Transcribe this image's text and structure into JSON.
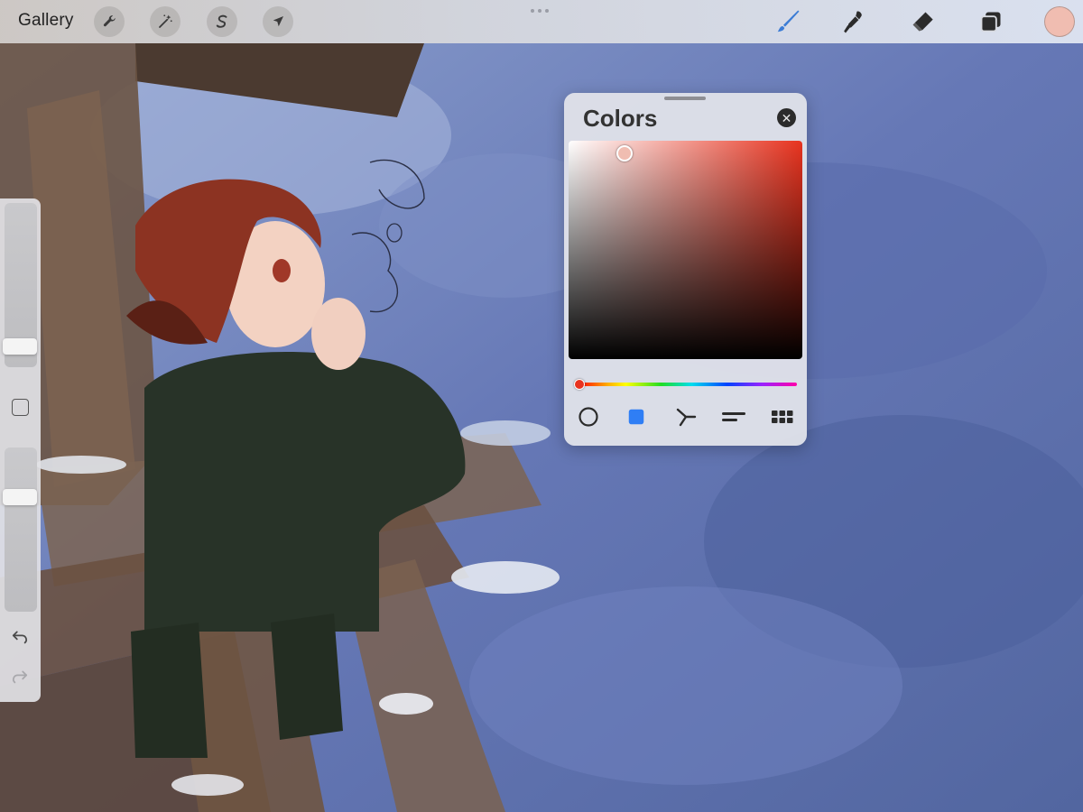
{
  "toolbar": {
    "gallery_label": "Gallery",
    "left_tools": [
      "actions-wrench-icon",
      "adjustments-wand-icon",
      "selection-s-icon",
      "transform-arrow-icon"
    ],
    "right_tools": [
      "brush-icon",
      "smudge-icon",
      "eraser-icon",
      "layers-icon"
    ],
    "accent_color": "#3a7bd5",
    "current_color": "#f0bdb1"
  },
  "colors_panel": {
    "title": "Colors",
    "base_hue_color": "#e8331f",
    "modes": [
      "disc-icon",
      "classic-icon",
      "harmony-icon",
      "value-icon",
      "palettes-icon"
    ],
    "active_mode": "classic-icon",
    "active_mode_color": "#2f7ef5"
  },
  "sidebar": {
    "icons": [
      "modify-square-icon",
      "undo-icon",
      "redo-icon"
    ]
  }
}
